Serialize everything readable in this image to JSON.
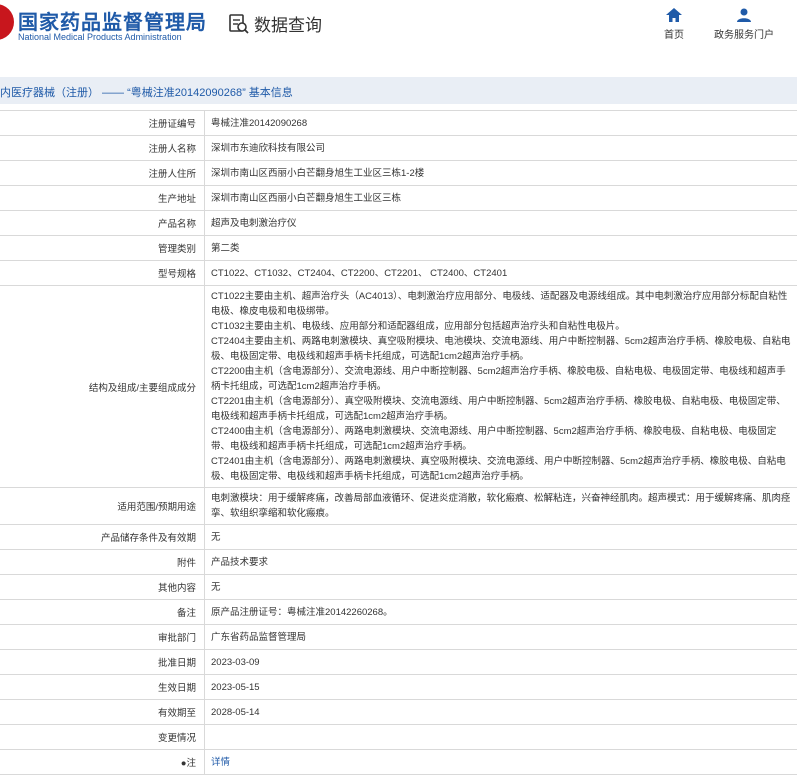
{
  "header": {
    "logo_cn": "国家药品监督管理局",
    "logo_en": "National Medical Products Administration",
    "data_query": "数据查询",
    "nav_home": "首页",
    "nav_portal": "政务服务门户"
  },
  "page_title": "内医疗器械（注册） —— “粤械注准20142090268” 基本信息",
  "rows": [
    {
      "label": "注册证编号",
      "value": "粤械注准20142090268"
    },
    {
      "label": "注册人名称",
      "value": "深圳市东迪欣科技有限公司"
    },
    {
      "label": "注册人住所",
      "value": "深圳市南山区西丽小白芒翻身旭生工业区三栋1-2楼"
    },
    {
      "label": "生产地址",
      "value": "深圳市南山区西丽小白芒翻身旭生工业区三栋"
    },
    {
      "label": "产品名称",
      "value": "超声及电刺激治疗仪"
    },
    {
      "label": "管理类别",
      "value": "第二类"
    },
    {
      "label": "型号规格",
      "value": "CT1022、CT1032、CT2404、CT2200、CT2201、 CT2400、CT2401"
    }
  ],
  "structure": {
    "label": "结构及组成/主要组成成分",
    "lines": [
      "CT1022主要由主机、超声治疗头（AC4013）、电刺激治疗应用部分、电极线、适配器及电源线组成。其中电刺激治疗应用部分标配自粘性电极、橡皮电极和电极绑带。",
      "CT1032主要由主机、电极线、应用部分和适配器组成，应用部分包括超声治疗头和自粘性电极片。",
      "CT2404主要由主机、两路电刺激模块、真空吸附模块、电池模块、交流电源线、用户中断控制器、5cm2超声治疗手柄、橡胶电极、自粘电极、电极固定带、电极线和超声手柄卡托组成，可选配1cm2超声治疗手柄。",
      "CT2200由主机（含电源部分）、交流电源线、用户中断控制器、5cm2超声治疗手柄、橡胶电极、自粘电极、电极固定带、电极线和超声手柄卡托组成，可选配1cm2超声治疗手柄。",
      "CT2201由主机（含电源部分）、真空吸附模块、交流电源线、用户中断控制器、5cm2超声治疗手柄、橡胶电极、自粘电极、电极固定带、电极线和超声手柄卡托组成，可选配1cm2超声治疗手柄。",
      "CT2400由主机（含电源部分）、两路电刺激模块、交流电源线、用户中断控制器、5cm2超声治疗手柄、橡胶电极、自粘电极、电极固定带、电极线和超声手柄卡托组成，可选配1cm2超声治疗手柄。",
      "CT2401由主机（含电源部分）、两路电刺激模块、真空吸附模块、交流电源线、用户中断控制器、5cm2超声治疗手柄、橡胶电极、自粘电极、电极固定带、电极线和超声手柄卡托组成，可选配1cm2超声治疗手柄。"
    ]
  },
  "scope": {
    "label": "适用范围/预期用途",
    "value": "电刺激模块：用于缓解疼痛，改善局部血液循环、促进炎症消散，软化瘢痕、松解粘连，兴奋神经肌肉。超声模式：用于缓解疼痛、肌肉痉挛、软组织挛缩和软化瘢痕。"
  },
  "rows2": [
    {
      "label": "产品储存条件及有效期",
      "value": "无"
    },
    {
      "label": "附件",
      "value": "产品技术要求"
    },
    {
      "label": "其他内容",
      "value": "无"
    },
    {
      "label": "备注",
      "value": "原产品注册证号：粤械注准20142260268。"
    },
    {
      "label": "审批部门",
      "value": "广东省药品监督管理局"
    },
    {
      "label": "批准日期",
      "value": "2023-03-09"
    },
    {
      "label": "生效日期",
      "value": "2023-05-15"
    },
    {
      "label": "有效期至",
      "value": "2028-05-14"
    },
    {
      "label": "变更情况",
      "value": ""
    }
  ],
  "note": {
    "label": "●注",
    "link": "详情"
  },
  "colors": {
    "brand_blue": "#1f5aa8",
    "titlebar_bg": "#e9eef5",
    "border": "#d9d9d9"
  }
}
